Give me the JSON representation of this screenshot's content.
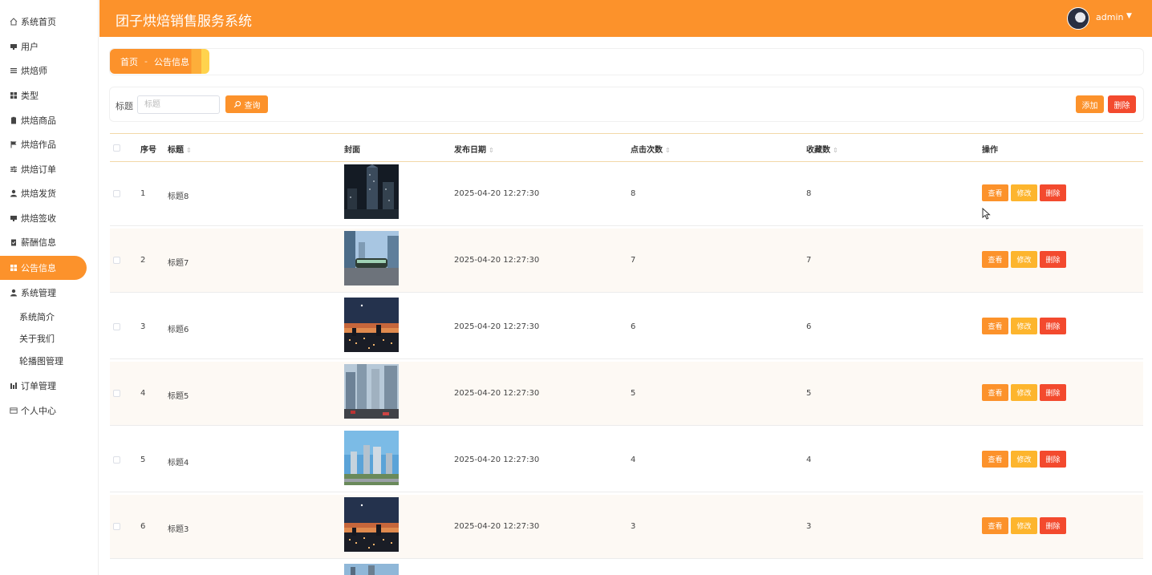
{
  "app": {
    "title": "团子烘焙销售服务系统",
    "user": "admin"
  },
  "sidebar": {
    "items": [
      {
        "label": "系统首页",
        "icon": "home-icon"
      },
      {
        "label": "用户",
        "icon": "monitor-icon"
      },
      {
        "label": "烘焙师",
        "icon": "list-icon"
      },
      {
        "label": "类型",
        "icon": "grid-icon"
      },
      {
        "label": "烘焙商品",
        "icon": "clipboard-icon"
      },
      {
        "label": "烘焙作品",
        "icon": "flag-icon"
      },
      {
        "label": "烘焙订单",
        "icon": "sliders-icon"
      },
      {
        "label": "烘焙发货",
        "icon": "user-icon"
      },
      {
        "label": "烘焙签收",
        "icon": "monitor-icon"
      },
      {
        "label": "薪酬信息",
        "icon": "clipboard-check-icon"
      },
      {
        "label": "公告信息",
        "icon": "grid-icon",
        "active": true
      },
      {
        "label": "系统管理",
        "icon": "user-icon"
      }
    ],
    "sub_items": [
      "系统简介",
      "关于我们",
      "轮播图管理"
    ],
    "bottom_items": [
      {
        "label": "订单管理",
        "icon": "bar-chart-icon"
      },
      {
        "label": "个人中心",
        "icon": "card-icon"
      }
    ]
  },
  "breadcrumb": {
    "home": "首页",
    "sep": "-",
    "current": "公告信息"
  },
  "search": {
    "label": "标题",
    "placeholder": "标题",
    "query_button": "查询",
    "add_button": "添加",
    "delete_button": "删除"
  },
  "table": {
    "headers": {
      "index": "序号",
      "title": "标题",
      "cover": "封面",
      "date": "发布日期",
      "clicks": "点击次数",
      "favorites": "收藏数",
      "actions": "操作"
    },
    "row_actions": {
      "view": "查看",
      "edit": "修改",
      "delete": "删除"
    },
    "rows": [
      {
        "index": "1",
        "title": "标题8",
        "date": "2025-04-20 12:27:30",
        "clicks": "8",
        "favorites": "8",
        "cover": "night-skyscraper"
      },
      {
        "index": "2",
        "title": "标题7",
        "date": "2025-04-20 12:27:30",
        "clicks": "7",
        "favorites": "7",
        "cover": "city-tram"
      },
      {
        "index": "3",
        "title": "标题6",
        "date": "2025-04-20 12:27:30",
        "clicks": "6",
        "favorites": "6",
        "cover": "dusk-skyline"
      },
      {
        "index": "4",
        "title": "标题5",
        "date": "2025-04-20 12:27:30",
        "clicks": "5",
        "favorites": "5",
        "cover": "street-towers"
      },
      {
        "index": "5",
        "title": "标题4",
        "date": "2025-04-20 12:27:30",
        "clicks": "4",
        "favorites": "4",
        "cover": "blue-sky-towers"
      },
      {
        "index": "6",
        "title": "标题3",
        "date": "2025-04-20 12:27:30",
        "clicks": "3",
        "favorites": "3",
        "cover": "dusk-skyline"
      }
    ]
  },
  "colors": {
    "primary": "#fc922b",
    "warning": "#fdb52d",
    "danger": "#f34a2e"
  }
}
